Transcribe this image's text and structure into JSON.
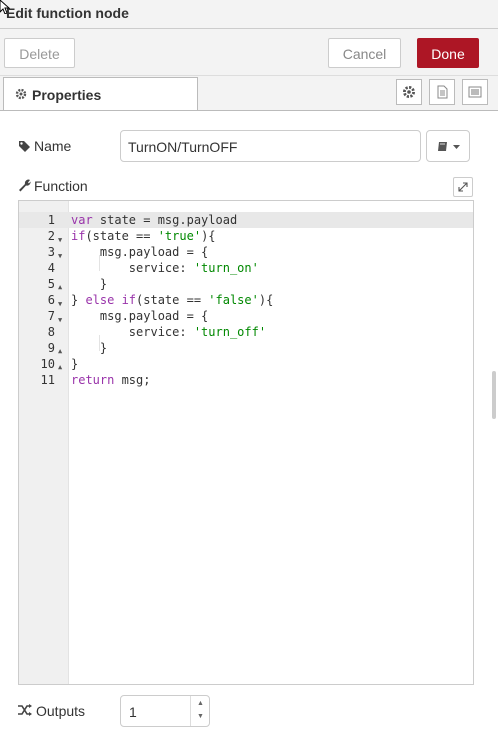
{
  "dialog": {
    "title": "Edit function node"
  },
  "toolbar": {
    "delete_label": "Delete",
    "cancel_label": "Cancel",
    "done_label": "Done"
  },
  "tabs": {
    "properties_label": "Properties"
  },
  "form": {
    "name_label": "Name",
    "name_value": "TurnON/TurnOFF",
    "function_label": "Function",
    "outputs_label": "Outputs",
    "outputs_value": "1"
  },
  "code": {
    "lines": [
      "var state = msg.payload",
      "if(state == 'true'){",
      "    msg.payload = {",
      "        service: 'turn_on'",
      "    }",
      "} else if(state == 'false'){",
      "    msg.payload = {",
      "        service: 'turn_off'",
      "    }",
      "}",
      "return msg;"
    ],
    "line_numbers": [
      "1",
      "2",
      "3",
      "4",
      "5",
      "6",
      "7",
      "8",
      "9",
      "10",
      "11"
    ]
  },
  "colors": {
    "done_bg": "#ad1625",
    "keyword": "#993399",
    "string": "#008800"
  }
}
